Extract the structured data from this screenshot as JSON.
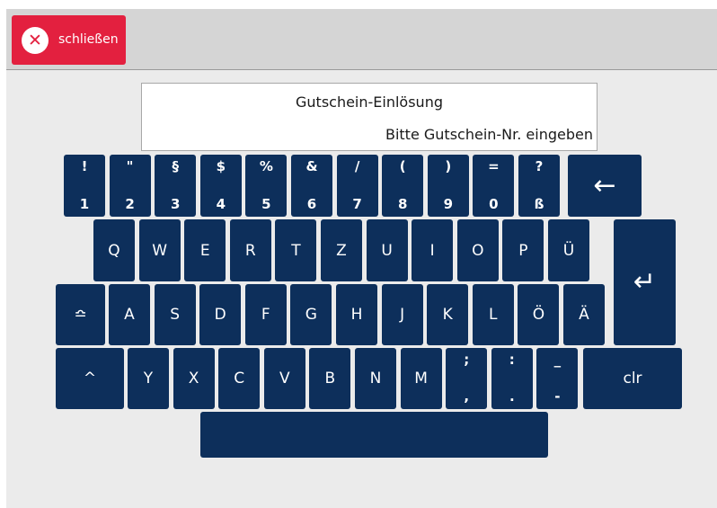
{
  "toolbar": {
    "close_label": "schließen",
    "close_icon": "close-circle-icon"
  },
  "display": {
    "title": "Gutschein-Einlösung",
    "prompt": "Bitte Gutschein-Nr. eingeben"
  },
  "keyboard": {
    "row1": [
      {
        "top": "!",
        "bottom": "1"
      },
      {
        "top": "\"",
        "bottom": "2"
      },
      {
        "top": "§",
        "bottom": "3"
      },
      {
        "top": "$",
        "bottom": "4"
      },
      {
        "top": "%",
        "bottom": "5"
      },
      {
        "top": "&",
        "bottom": "6"
      },
      {
        "top": "/",
        "bottom": "7"
      },
      {
        "top": "(",
        "bottom": "8"
      },
      {
        "top": ")",
        "bottom": "9"
      },
      {
        "top": "=",
        "bottom": "0"
      },
      {
        "top": "?",
        "bottom": "ß"
      }
    ],
    "backspace": "←",
    "row2": [
      "Q",
      "W",
      "E",
      "R",
      "T",
      "Z",
      "U",
      "I",
      "O",
      "P",
      "Ü"
    ],
    "enter": "↵",
    "caps": "≏",
    "row3": [
      "A",
      "S",
      "D",
      "F",
      "G",
      "H",
      "J",
      "K",
      "L",
      "Ö",
      "Ä"
    ],
    "shift": "^",
    "row4": [
      "Y",
      "X",
      "C",
      "V",
      "B",
      "N",
      "M"
    ],
    "row4_dual": [
      {
        "top": ";",
        "bottom": ","
      },
      {
        "top": ":",
        "bottom": "."
      },
      {
        "top": "_",
        "bottom": "-"
      }
    ],
    "clear": "clr",
    "space": ""
  }
}
